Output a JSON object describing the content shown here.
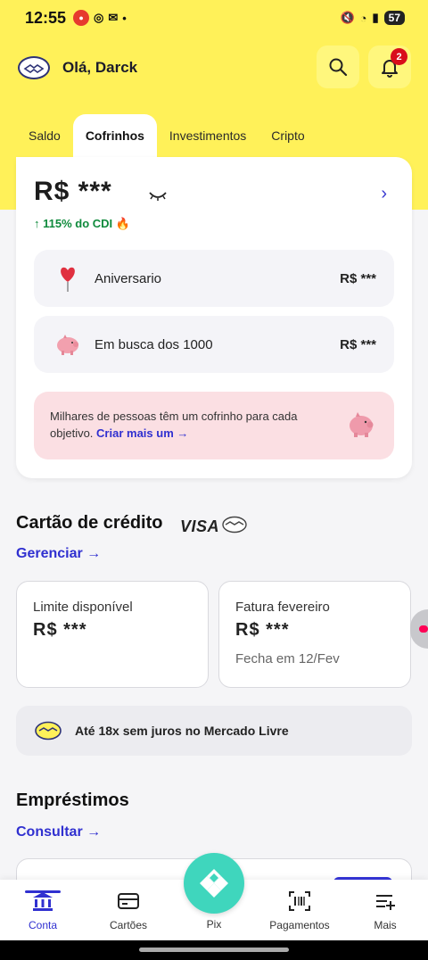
{
  "status_bar": {
    "time": "12:55",
    "battery": "57"
  },
  "header": {
    "greeting": "Olá, Darck",
    "notification_count": "2"
  },
  "tabs": [
    {
      "label": "Saldo"
    },
    {
      "label": "Cofrinhos"
    },
    {
      "label": "Investimentos"
    },
    {
      "label": "Cripto"
    }
  ],
  "cofrinhos": {
    "total": "R$ ***",
    "yield": "↑ 115% do CDI",
    "items": [
      {
        "name": "Aniversario",
        "value": "R$ ***",
        "icon": "heart-balloon-icon"
      },
      {
        "name": "Em busca dos 1000",
        "value": "R$ ***",
        "icon": "piggy-bank-icon"
      }
    ],
    "promo_text": "Milhares de pessoas têm um cofrinho para cada objetivo.",
    "promo_link": "Criar mais um →"
  },
  "credit_card": {
    "title": "Cartão de crédito",
    "brand": "VISA",
    "manage_link": "Gerenciar →",
    "limit_label": "Limite disponível",
    "limit_value": "R$ ***",
    "invoice_label": "Fatura fevereiro",
    "invoice_value": "R$ ***",
    "invoice_due": "Fecha em 12/Fev"
  },
  "banner": {
    "text": "Até 18x sem juros no Mercado Livre"
  },
  "loans": {
    "title": "Empréstimos",
    "link": "Consultar →"
  },
  "bottom_nav": [
    {
      "label": "Conta",
      "icon": "bank-icon"
    },
    {
      "label": "Cartões",
      "icon": "card-icon"
    },
    {
      "label": "Pix",
      "icon": "pix-icon"
    },
    {
      "label": "Pagamentos",
      "icon": "barcode-icon"
    },
    {
      "label": "Mais",
      "icon": "more-list-icon"
    }
  ],
  "colors": {
    "brand_yellow": "#fff159",
    "accent_blue": "#3030d0",
    "pix_green": "#3fd6bd",
    "yield_green": "#0f8a3c"
  }
}
